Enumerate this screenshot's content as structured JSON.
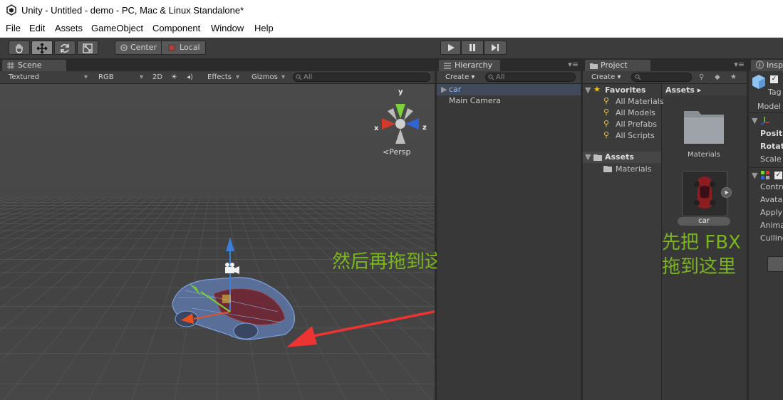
{
  "window": {
    "title": "Unity - Untitled - demo - PC, Mac & Linux Standalone*"
  },
  "menu": [
    "File",
    "Edit",
    "Assets",
    "GameObject",
    "Component",
    "Window",
    "Help"
  ],
  "toolbar": {
    "pivot_label": "Center",
    "space_label": "Local"
  },
  "scene": {
    "tab": "Scene",
    "shading": "Textured",
    "render_mode": "RGB",
    "mode_2d": "2D",
    "effects": "Effects",
    "gizmos": "Gizmos",
    "search_placeholder": "All",
    "persp_label": "Persp",
    "axes": {
      "x": "x",
      "y": "y",
      "z": "z"
    }
  },
  "hierarchy": {
    "tab": "Hierarchy",
    "create": "Create",
    "search_placeholder": "All",
    "items": [
      "car",
      "Main Camera"
    ]
  },
  "project": {
    "tab": "Project",
    "create": "Create",
    "favorites_label": "Favorites",
    "favorites": [
      "All Materials",
      "All Models",
      "All Prefabs",
      "All Scripts"
    ],
    "assets_label": "Assets",
    "assets_tree": [
      "Materials"
    ],
    "breadcrumb": "Assets",
    "grid": [
      {
        "name": "Materials",
        "kind": "folder"
      },
      {
        "name": "car",
        "kind": "model"
      }
    ]
  },
  "inspector": {
    "tab": "Inspector",
    "rows": [
      "Tag",
      "Model",
      "Position",
      "Rotation",
      "Scale",
      "Controller",
      "Avatar",
      "Apply Root Motion",
      "Animate Physics",
      "Culling Mode"
    ]
  },
  "annotations": {
    "drag_fbx_line1": "先把 FBX",
    "drag_fbx_line2": "拖到这里",
    "drag_scene": "然后再拖到这里"
  },
  "colors": {
    "selection": "#8dbdf5",
    "annotation": "#7ab51d",
    "arrow": "#ee3333"
  }
}
